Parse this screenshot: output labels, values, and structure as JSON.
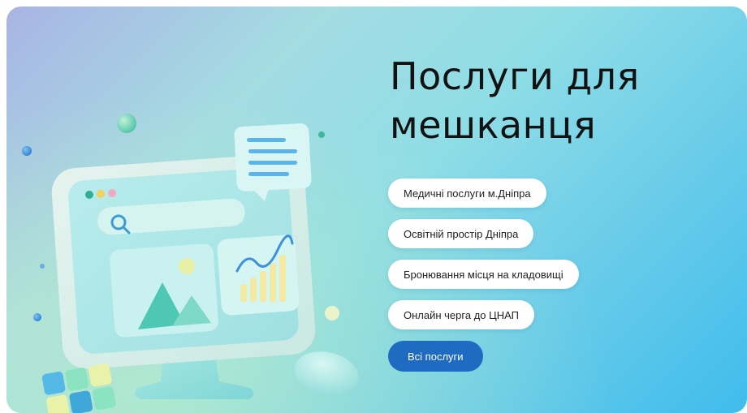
{
  "hero": {
    "title": "Послуги для мешканця",
    "services": [
      {
        "label": "Медичні послуги м.Дніпра"
      },
      {
        "label": "Освітній простір Дніпра"
      },
      {
        "label": "Бронювання місця на кладовищі"
      },
      {
        "label": "Онлайн черга до ЦНАП"
      }
    ],
    "all_services_label": "Всі послуги"
  },
  "colors": {
    "accent_button": "#1e6cc1",
    "pill_background": "#ffffff",
    "title_text": "#121212",
    "gradient_left": "#a9b4e4",
    "gradient_right": "#3fbcec"
  },
  "icons": [
    "monitor-illustration",
    "search-icon",
    "image-icon",
    "chart-icon",
    "document-icon",
    "cube-icon"
  ]
}
